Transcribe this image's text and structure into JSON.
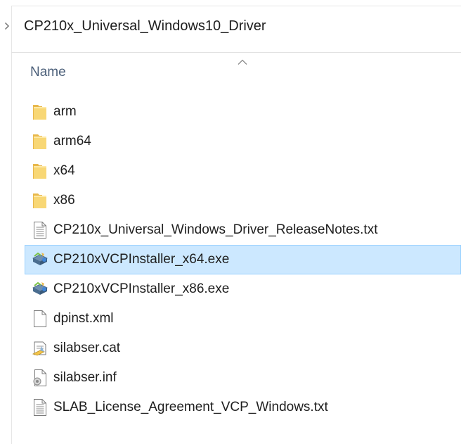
{
  "breadcrumb": {
    "current_folder": "CP210x_Universal_Windows10_Driver"
  },
  "columns": {
    "name": "Name"
  },
  "files": [
    {
      "name": "arm",
      "icon": "folder-icon",
      "kind": "folder",
      "selected": false
    },
    {
      "name": "arm64",
      "icon": "folder-icon",
      "kind": "folder",
      "selected": false
    },
    {
      "name": "x64",
      "icon": "folder-icon",
      "kind": "folder",
      "selected": false
    },
    {
      "name": "x86",
      "icon": "folder-icon",
      "kind": "folder",
      "selected": false
    },
    {
      "name": "CP210x_Universal_Windows_Driver_ReleaseNotes.txt",
      "icon": "text-file-icon",
      "kind": "txt",
      "selected": false
    },
    {
      "name": "CP210xVCPInstaller_x64.exe",
      "icon": "installer-icon",
      "kind": "exe",
      "selected": true
    },
    {
      "name": "CP210xVCPInstaller_x86.exe",
      "icon": "installer-icon",
      "kind": "exe",
      "selected": false
    },
    {
      "name": "dpinst.xml",
      "icon": "blank-file-icon",
      "kind": "xml",
      "selected": false
    },
    {
      "name": "silabser.cat",
      "icon": "catalog-icon",
      "kind": "cat",
      "selected": false
    },
    {
      "name": "silabser.inf",
      "icon": "settings-file-icon",
      "kind": "inf",
      "selected": false
    },
    {
      "name": "SLAB_License_Agreement_VCP_Windows.txt",
      "icon": "text-file-icon",
      "kind": "txt",
      "selected": false
    }
  ],
  "colors": {
    "selection": "#cce8ff",
    "selection_border": "#99d1ff",
    "header_text": "#4c607a",
    "folder": "#f8d775"
  }
}
